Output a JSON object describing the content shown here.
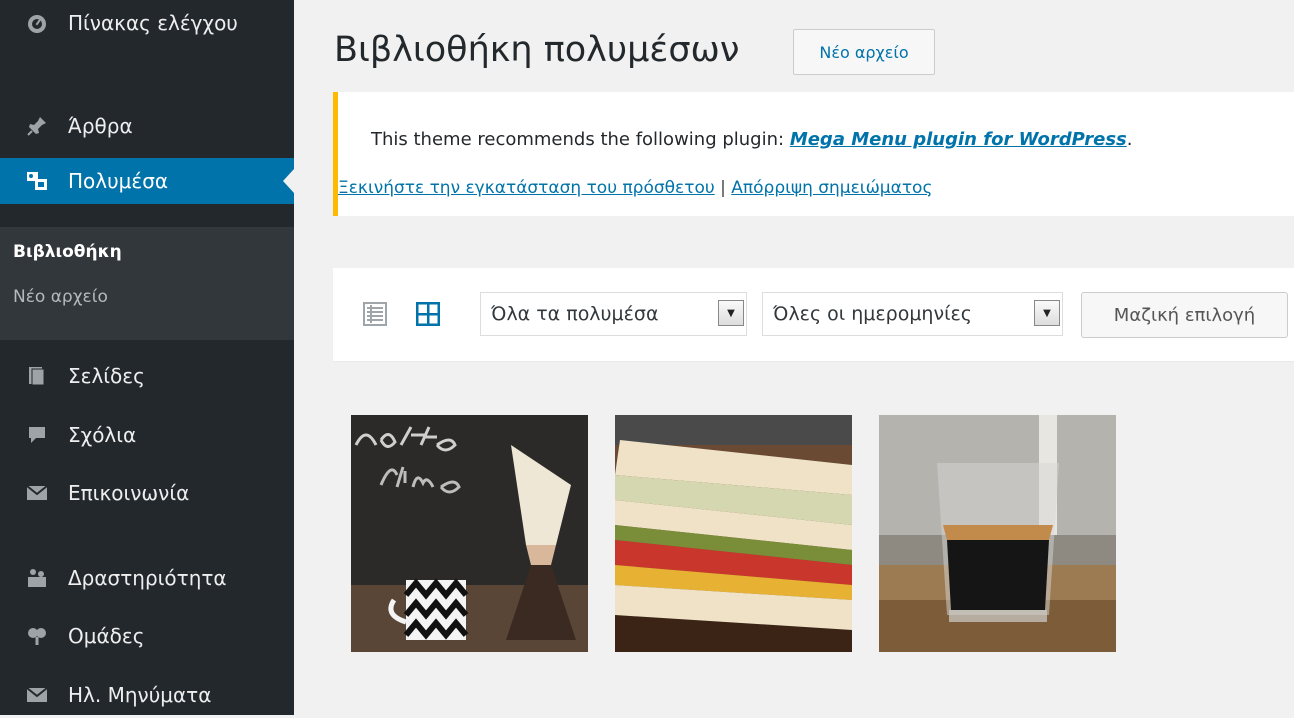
{
  "sidebar": {
    "items": [
      {
        "label": "Πίνακας ελέγχου",
        "icon": "dashboard-icon"
      },
      {
        "label": "Άρθρα",
        "icon": "pin-icon"
      },
      {
        "label": "Πολυμέσα",
        "icon": "media-icon"
      },
      {
        "label": "Σελίδες",
        "icon": "pages-icon"
      },
      {
        "label": "Σχόλια",
        "icon": "comments-icon"
      },
      {
        "label": "Επικοινωνία",
        "icon": "mail-icon"
      },
      {
        "label": "Δραστηριότητα",
        "icon": "activity-icon"
      },
      {
        "label": "Ομάδες",
        "icon": "groups-icon"
      },
      {
        "label": "Ηλ. Μηνύματα",
        "icon": "mail-icon"
      }
    ],
    "submenu": {
      "current": "Βιβλιοθήκη",
      "other": "Νέο αρχείο"
    }
  },
  "header": {
    "title": "Βιβλιοθήκη πολυμέσων",
    "new_button": "Νέο αρχείο"
  },
  "notice": {
    "prefix": "This theme recommends the following plugin: ",
    "plugin_link": "Mega Menu plugin for WordPress",
    "suffix": ".",
    "install_link": "Ξεκινήστε την εγκατάσταση του πρόσθετου",
    "separator": " | ",
    "dismiss_link": "Απόρριψη σημειώματος"
  },
  "toolbar": {
    "filter_type": "Όλα τα πολυμέσα",
    "filter_date": "Όλες οι ημερομηνίες",
    "bulk_select": "Μαζική επιλογή"
  },
  "colors": {
    "accent": "#0073aa",
    "sidebar": "#23282d",
    "notice_border": "#ffb900"
  },
  "media": [
    {
      "kind": "coffee-time-photo"
    },
    {
      "kind": "sandwich-photo"
    },
    {
      "kind": "espresso-glass-photo"
    }
  ]
}
